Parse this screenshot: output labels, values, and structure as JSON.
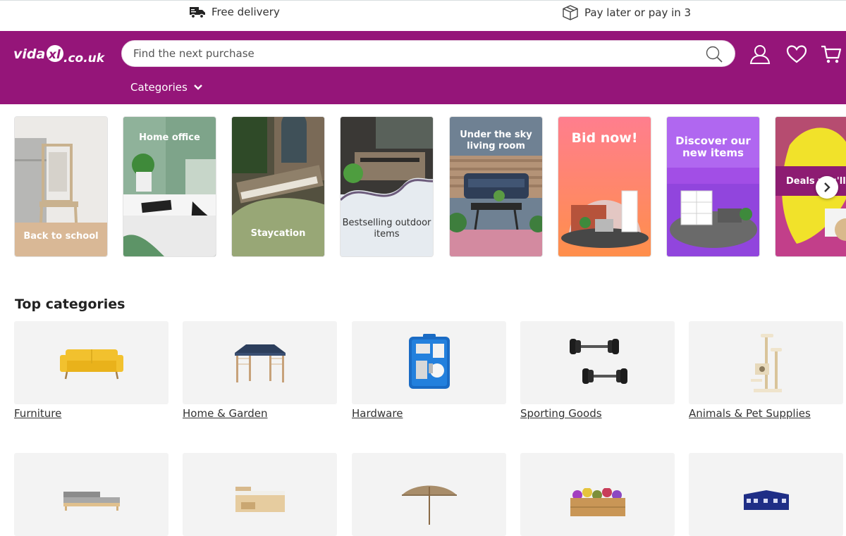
{
  "topbar": {
    "delivery": {
      "icon": "delivery-truck-icon",
      "label": "Free delivery"
    },
    "paylater": {
      "icon": "box-icon",
      "label": "Pay later or pay in 3"
    }
  },
  "header": {
    "brand_color": "#951579",
    "logo_text": "vidaXL.co.uk",
    "search": {
      "placeholder": "Find the next purchase",
      "value": ""
    },
    "categories_label": "Categories",
    "icons": [
      "account-icon",
      "wishlist-heart-icon",
      "cart-icon"
    ]
  },
  "promo_tiles": [
    {
      "label": "Back to school"
    },
    {
      "label": "Home office"
    },
    {
      "label": "Staycation"
    },
    {
      "label": "Bestselling outdoor items"
    },
    {
      "label": "Under the sky living room"
    },
    {
      "label": "Bid now!"
    },
    {
      "label": "Discover our new items"
    },
    {
      "label": "Deals you'll love"
    }
  ],
  "top_categories": {
    "title": "Top categories",
    "items": [
      {
        "label": "Furniture",
        "icon": "sofa-icon"
      },
      {
        "label": "Home & Garden",
        "icon": "gazebo-icon"
      },
      {
        "label": "Hardware",
        "icon": "spray-gun-kit-icon"
      },
      {
        "label": "Sporting Goods",
        "icon": "dumbbells-icon"
      },
      {
        "label": "Animals & Pet Supplies",
        "icon": "cat-tree-icon"
      }
    ],
    "second_row_icons": [
      "garden-lounge-set-icon",
      "bed-frame-icon",
      "parasol-icon",
      "raised-planter-icon",
      "party-tent-icon"
    ]
  }
}
